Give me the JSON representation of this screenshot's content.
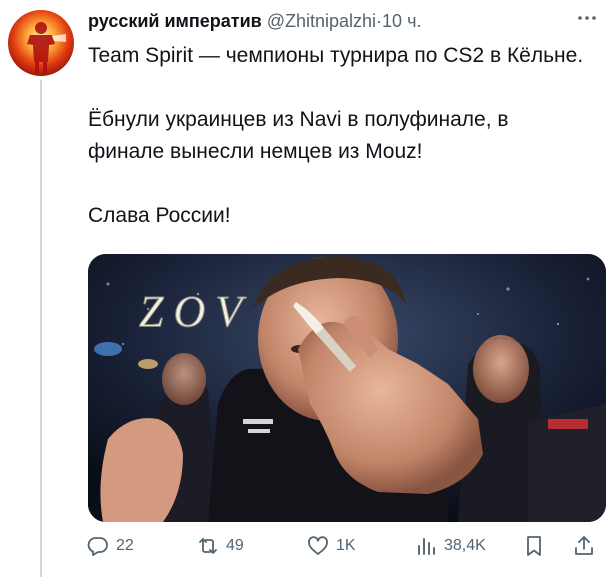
{
  "author": {
    "name": "русский императив",
    "handle": "@Zhitnipalzhi",
    "separator": "·",
    "time": "10 ч."
  },
  "tweet": {
    "paragraphs": [
      "Team Spirit — чемпионы турнира по CS2 в Кёльне.",
      "Ёбнули украинцев из Navi в полуфинале, в финале вынесли немцев из Mouz!",
      "Слава России!"
    ]
  },
  "media": {
    "overlay_text": "ZOV"
  },
  "actions": {
    "replies": "22",
    "reposts": "49",
    "likes": "1K",
    "views": "38,4K"
  },
  "icons": {
    "more": "more-icon",
    "reply": "reply-icon",
    "repost": "repost-icon",
    "like": "like-icon",
    "views": "views-icon",
    "bookmark": "bookmark-icon",
    "share": "share-icon"
  },
  "colors": {
    "text": "#0f1419",
    "secondary": "#536471",
    "thread_line": "#cfd9de"
  }
}
